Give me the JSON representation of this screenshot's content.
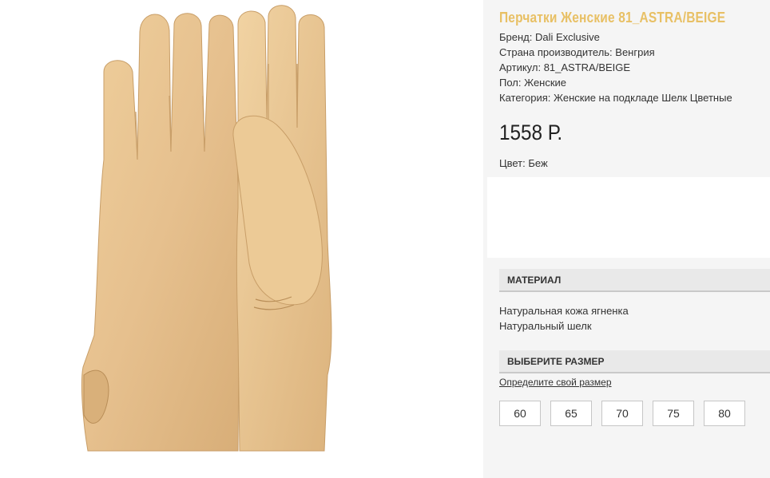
{
  "product": {
    "title": "Перчатки Женские 81_ASTRA/BEIGE",
    "specs": [
      "Бренд: Dali Exclusive",
      "Страна производитель: Венгрия",
      "Артикул: 81_ASTRA/BEIGE",
      "Пол: Женские",
      "Категория: Женские на подкладе Шелк Цветные"
    ],
    "price": "1558 Р.",
    "color_line": "Цвет: Беж"
  },
  "material": {
    "header": "МАТЕРИАЛ",
    "lines": [
      "Натуральная кожа ягненка",
      "Натуральный шелк"
    ]
  },
  "size": {
    "header": "ВЫБЕРИТЕ РАЗМЕР",
    "link": "Определите свой размер",
    "options": [
      "60",
      "65",
      "70",
      "75",
      "80"
    ]
  },
  "image": {
    "name": "beige-leather-gloves-photo",
    "accent_color": "#e8c065",
    "glove_color": "#e6c08e"
  }
}
